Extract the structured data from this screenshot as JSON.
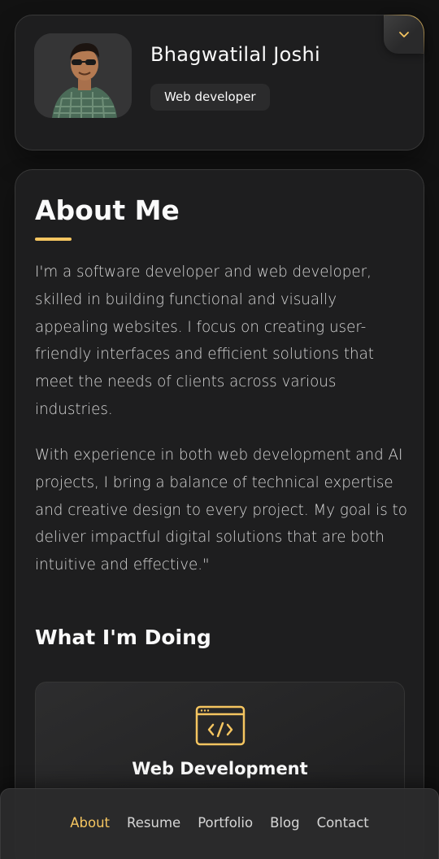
{
  "profile": {
    "name": "Bhagwatilal Joshi",
    "title": "Web developer",
    "avatar_alt": "Bhagwatilal Joshi"
  },
  "about": {
    "heading": "About Me",
    "paragraphs": [
      "I'm a software developer and web developer, skilled in building functional and visually appealing websites. I focus on creating user-friendly interfaces and efficient solutions that meet the needs of clients across various industries.",
      "With experience in both web development and AI projects, I bring a balance of technical expertise and creative design to every project. My goal is to deliver impactful digital solutions that are both intuitive and effective.\""
    ]
  },
  "services": {
    "heading": "What I'm Doing",
    "items": [
      {
        "title": "Web Development",
        "icon": "code-icon"
      }
    ]
  },
  "navbar": {
    "items": [
      "About",
      "Resume",
      "Portfolio",
      "Blog",
      "Contact"
    ],
    "active": "About"
  },
  "colors": {
    "accent": "#f5c560",
    "background": "#121212",
    "card": "#1e1e1f",
    "text": "#fafafa",
    "muted_text": "#d6d6d6"
  }
}
